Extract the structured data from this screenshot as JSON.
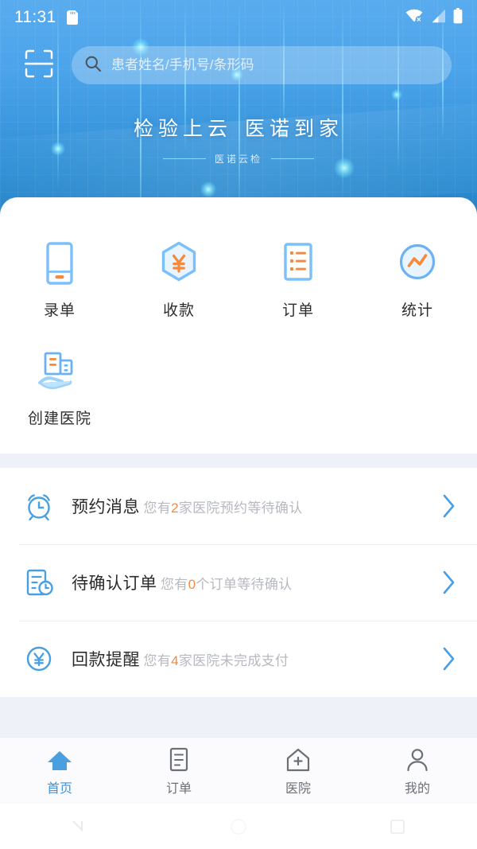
{
  "status_bar": {
    "time": "11:31",
    "sd_icon": "sd-card-icon",
    "wifi_icon": "wifi-off-icon",
    "signal_icon": "signal-bars-icon",
    "battery_icon": "battery-full-icon"
  },
  "header": {
    "scan_icon": "scan-qr-icon",
    "search": {
      "icon": "search-icon",
      "value": "",
      "placeholder": "患者姓名/手机号/条形码"
    },
    "banner_title_left": "检验上云",
    "banner_title_right": "医诺到家",
    "banner_subtitle": "医诺云检"
  },
  "quick_actions": [
    {
      "label": "录单",
      "icon": "order-entry-icon"
    },
    {
      "label": "收款",
      "icon": "payment-hexagon-yuan-icon"
    },
    {
      "label": "订单",
      "icon": "order-list-icon"
    },
    {
      "label": "统计",
      "icon": "statistics-chart-icon"
    },
    {
      "label": "创建医院",
      "icon": "create-hospital-icon"
    }
  ],
  "notices": [
    {
      "icon": "alarm-clock-icon",
      "title": "预约消息",
      "desc_before": "您有",
      "count": "2",
      "desc_after": "家医院预约等待确认",
      "arrow": "chevron-right-icon"
    },
    {
      "icon": "document-clock-icon",
      "title": "待确认订单",
      "desc_before": "您有",
      "count": "0",
      "desc_after": "个订单等待确认",
      "arrow": "chevron-right-icon"
    },
    {
      "icon": "yuan-circle-icon",
      "title": "回款提醒",
      "desc_before": "您有",
      "count": "4",
      "desc_after": "家医院未完成支付",
      "arrow": "chevron-right-icon"
    }
  ],
  "tabbar": [
    {
      "label": "首页",
      "icon": "home-icon",
      "active": true
    },
    {
      "label": "订单",
      "icon": "document-icon",
      "active": false
    },
    {
      "label": "医院",
      "icon": "hospital-icon",
      "active": false
    },
    {
      "label": "我的",
      "icon": "person-icon",
      "active": false
    }
  ],
  "system_nav": {
    "back": "nav-back-icon",
    "home": "nav-home-icon",
    "recents": "nav-recents-icon"
  },
  "colors": {
    "primary_blue": "#4ba3ea",
    "deep_blue": "#1f7cc0",
    "accent_orange": "#f58a3c",
    "icon_blue": "#7cc0fb",
    "tab_active": "#3c93de",
    "muted_text": "#b6b9bf"
  }
}
